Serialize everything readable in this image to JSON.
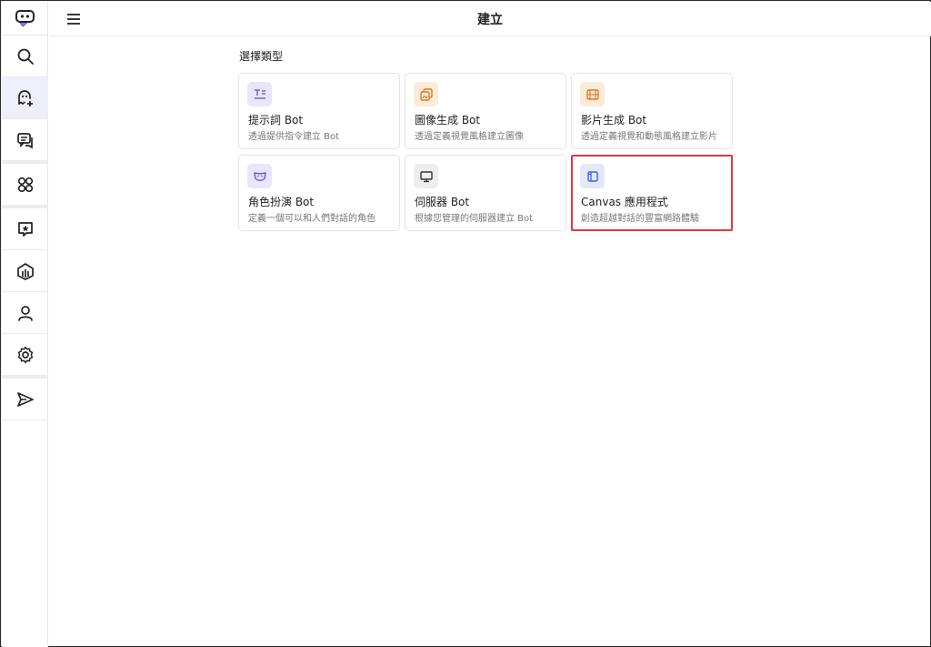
{
  "header": {
    "title": "建立"
  },
  "section": {
    "title": "選擇類型"
  },
  "cards": [
    {
      "title": "提示詞 Bot",
      "desc": "透過提供指令建立 Bot",
      "icon": "text-icon",
      "icon_bg": "#e9e5fb",
      "icon_color": "#6a5acd"
    },
    {
      "title": "圖像生成 Bot",
      "desc": "透過定義視覺風格建立圖像",
      "icon": "image-icon",
      "icon_bg": "#fdebd8",
      "icon_color": "#d77a2a"
    },
    {
      "title": "影片生成 Bot",
      "desc": "透過定義視覺和動態風格建立影片",
      "icon": "film-icon",
      "icon_bg": "#fdebd8",
      "icon_color": "#d77a2a"
    },
    {
      "title": "角色扮演 Bot",
      "desc": "定義一個可以和人們對話的角色",
      "icon": "mask-icon",
      "icon_bg": "#e9e5fb",
      "icon_color": "#6a5acd"
    },
    {
      "title": "伺服器 Bot",
      "desc": "根據您管理的伺服器建立 Bot",
      "icon": "monitor-icon",
      "icon_bg": "#eeeeee",
      "icon_color": "#333333"
    },
    {
      "title": "Canvas 應用程式",
      "desc": "創造超越對話的豐富網路體驗",
      "icon": "canvas-icon",
      "icon_bg": "#e3e9fb",
      "icon_color": "#3a63d8"
    }
  ],
  "sidebar": {
    "items": [
      "search-icon",
      "create-bot-icon",
      "chats-icon",
      "apps-grid-icon",
      "starred-icon",
      "creators-icon",
      "profile-icon",
      "settings-icon",
      "send-icon"
    ]
  },
  "colors": {
    "accent": "#6a5acd",
    "highlight_border": "#e0383e"
  }
}
